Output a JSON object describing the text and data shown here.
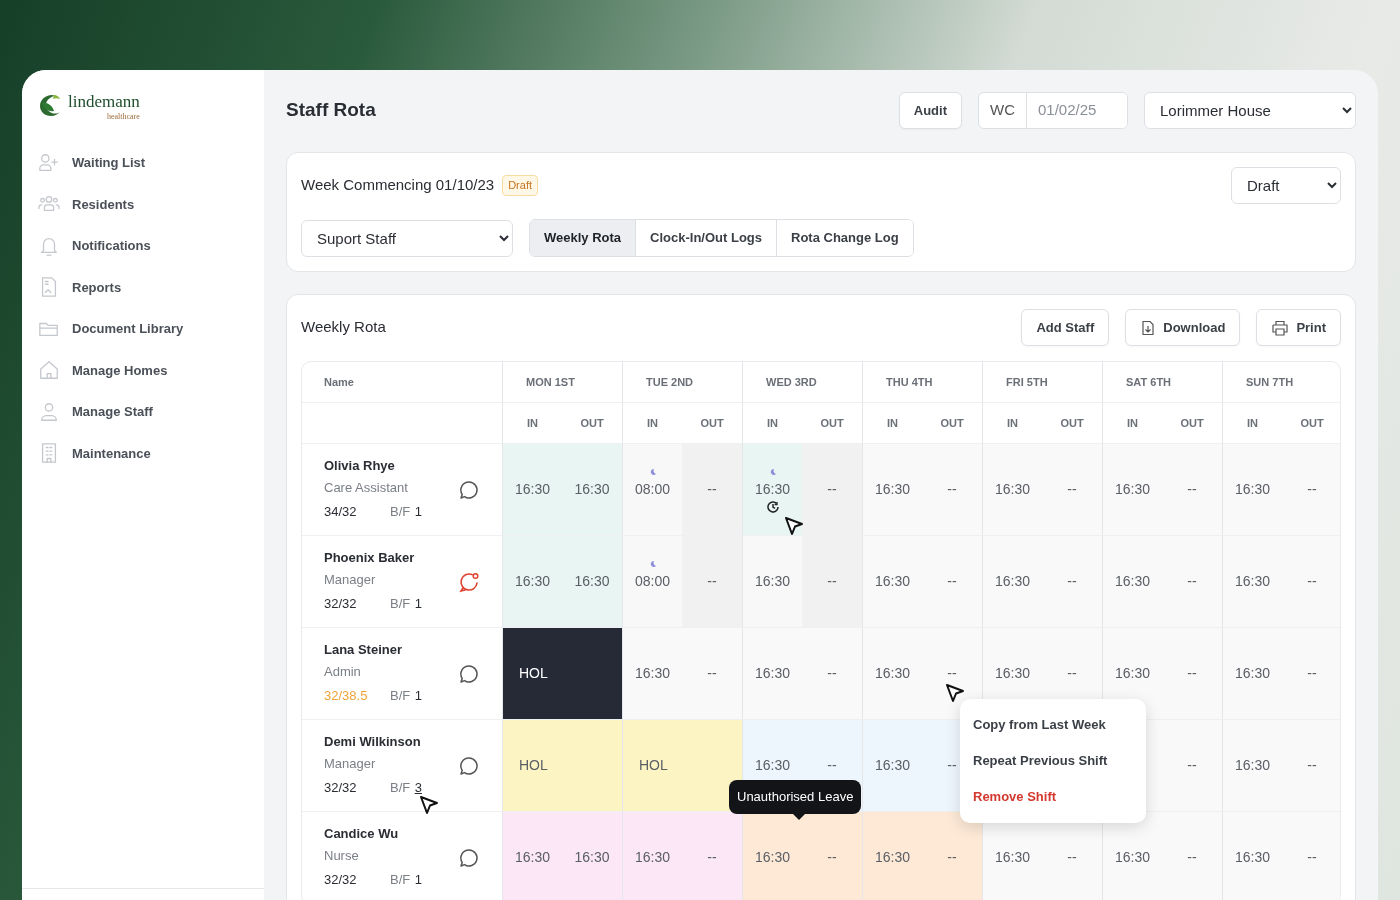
{
  "logo": {
    "name": "lindemann",
    "tagline": "healthcare"
  },
  "sidebar": {
    "items": [
      {
        "label": "Waiting List"
      },
      {
        "label": "Residents"
      },
      {
        "label": "Notifications"
      },
      {
        "label": "Reports"
      },
      {
        "label": "Document Library"
      },
      {
        "label": "Manage Homes"
      },
      {
        "label": "Manage Staff"
      },
      {
        "label": "Maintenance"
      }
    ]
  },
  "header": {
    "title": "Staff Rota",
    "audit_button": "Audit",
    "date_field": {
      "label": "WC",
      "placeholder": "01/02/25"
    },
    "home_select": "Lorimmer House"
  },
  "week_card": {
    "title": "Week Commencing 01/10/23",
    "badge": "Draft",
    "status_select": "Draft",
    "staff_select": "Suport Staff",
    "tabs": [
      {
        "label": "Weekly Rota",
        "selected": true
      },
      {
        "label": "Clock-In/Out Logs",
        "selected": false
      },
      {
        "label": "Rota Change Log",
        "selected": false
      }
    ]
  },
  "rota": {
    "title": "Weekly Rota",
    "buttons": [
      {
        "label": "Add Staff"
      },
      {
        "label": "Download"
      },
      {
        "label": "Print"
      }
    ],
    "name_column": "Name",
    "days": [
      {
        "label": "MON 1ST",
        "in": "IN",
        "out": "OUT"
      },
      {
        "label": "TUE 2ND",
        "in": "IN",
        "out": "OUT"
      },
      {
        "label": "WED 3RD",
        "in": "IN",
        "out": "OUT"
      },
      {
        "label": "THU 4TH",
        "in": "IN",
        "out": "OUT"
      },
      {
        "label": "FRI 5TH",
        "in": "IN",
        "out": "OUT"
      },
      {
        "label": "SAT 6TH",
        "in": "IN",
        "out": "OUT"
      },
      {
        "label": "SUN 7TH",
        "in": "IN",
        "out": "OUT"
      }
    ],
    "rows": [
      {
        "name": "Olivia Rhye",
        "role": "Care Assistant",
        "hours": "34/32",
        "over_hours": false,
        "bf_label": "B/F",
        "bf": "1",
        "bf_hover": false,
        "comment_alert": false,
        "cells": [
          {
            "kind": "shift",
            "night": false,
            "clock": false,
            "in": {
              "time": "16:30",
              "color": "#e9f5f3"
            },
            "out": {
              "time": "16:30",
              "color": "#e9f5f3"
            }
          },
          {
            "kind": "shift",
            "night": true,
            "clock": false,
            "in": {
              "time": "08:00",
              "color": "#f8f8f8"
            },
            "out": {
              "time": "--",
              "color": "#f1f1f1"
            }
          },
          {
            "kind": "shift",
            "night": true,
            "clock": true,
            "in": {
              "time": "16:30",
              "color": "#e9f5f3"
            },
            "out": {
              "time": "--",
              "color": "#f1f1f1"
            }
          },
          {
            "kind": "shift",
            "night": false,
            "clock": false,
            "in": {
              "time": "16:30",
              "color": "#f9f9f9"
            },
            "out": {
              "time": "--",
              "color": "#f9f9f9"
            }
          },
          {
            "kind": "shift",
            "night": false,
            "clock": false,
            "in": {
              "time": "16:30",
              "color": "#f9f9f9"
            },
            "out": {
              "time": "--",
              "color": "#f9f9f9"
            }
          },
          {
            "kind": "shift",
            "night": false,
            "clock": false,
            "in": {
              "time": "16:30",
              "color": "#f9f9f9"
            },
            "out": {
              "time": "--",
              "color": "#f9f9f9"
            }
          },
          {
            "kind": "shift",
            "night": false,
            "clock": false,
            "in": {
              "time": "16:30",
              "color": "#f9f9f9"
            },
            "out": {
              "time": "--",
              "color": "#f9f9f9"
            }
          }
        ]
      },
      {
        "name": "Phoenix Baker",
        "role": "Manager",
        "hours": "32/32",
        "over_hours": false,
        "bf_label": "B/F",
        "bf": "1",
        "bf_hover": false,
        "comment_alert": true,
        "cells": [
          {
            "kind": "shift",
            "night": false,
            "clock": false,
            "in": {
              "time": "16:30",
              "color": "#e9f5f3"
            },
            "out": {
              "time": "16:30",
              "color": "#e9f5f3"
            }
          },
          {
            "kind": "shift",
            "night": true,
            "clock": false,
            "in": {
              "time": "08:00",
              "color": "#f8f8f8"
            },
            "out": {
              "time": "--",
              "color": "#f1f1f1"
            }
          },
          {
            "kind": "shift",
            "night": false,
            "clock": false,
            "in": {
              "time": "16:30",
              "color": "#f8f8f8"
            },
            "out": {
              "time": "--",
              "color": "#f1f1f1"
            }
          },
          {
            "kind": "shift",
            "night": false,
            "clock": false,
            "in": {
              "time": "16:30",
              "color": "#f9f9f9"
            },
            "out": {
              "time": "--",
              "color": "#f9f9f9"
            }
          },
          {
            "kind": "shift",
            "night": false,
            "clock": false,
            "in": {
              "time": "16:30",
              "color": "#f9f9f9"
            },
            "out": {
              "time": "--",
              "color": "#f9f9f9"
            }
          },
          {
            "kind": "shift",
            "night": false,
            "clock": false,
            "in": {
              "time": "16:30",
              "color": "#f9f9f9"
            },
            "out": {
              "time": "--",
              "color": "#f9f9f9"
            }
          },
          {
            "kind": "shift",
            "night": false,
            "clock": false,
            "in": {
              "time": "16:30",
              "color": "#f9f9f9"
            },
            "out": {
              "time": "--",
              "color": "#f9f9f9"
            }
          }
        ]
      },
      {
        "name": "Lana Steiner",
        "role": "Admin",
        "hours": "32/38.5",
        "over_hours": true,
        "bf_label": "B/F",
        "bf": "1",
        "bf_hover": false,
        "comment_alert": false,
        "cells": [
          {
            "kind": "holiday",
            "color": "#252a36",
            "label": "HOL"
          },
          {
            "kind": "shift",
            "night": false,
            "clock": false,
            "in": {
              "time": "16:30",
              "color": "#f9f9f9"
            },
            "out": {
              "time": "--",
              "color": "#f9f9f9"
            }
          },
          {
            "kind": "shift",
            "night": false,
            "clock": false,
            "in": {
              "time": "16:30",
              "color": "#f9f9f9"
            },
            "out": {
              "time": "--",
              "color": "#f9f9f9"
            }
          },
          {
            "kind": "shift",
            "night": false,
            "clock": false,
            "in": {
              "time": "16:30",
              "color": "#f9f9f9"
            },
            "out": {
              "time": "--",
              "color": "#f9f9f9"
            }
          },
          {
            "kind": "shift",
            "night": false,
            "clock": false,
            "in": {
              "time": "16:30",
              "color": "#f9f9f9"
            },
            "out": {
              "time": "--",
              "color": "#f9f9f9"
            }
          },
          {
            "kind": "shift",
            "night": false,
            "clock": false,
            "in": {
              "time": "16:30",
              "color": "#f9f9f9"
            },
            "out": {
              "time": "--",
              "color": "#f9f9f9"
            }
          },
          {
            "kind": "shift",
            "night": false,
            "clock": false,
            "in": {
              "time": "16:30",
              "color": "#f9f9f9"
            },
            "out": {
              "time": "--",
              "color": "#f9f9f9"
            }
          }
        ]
      },
      {
        "name": "Demi Wilkinson",
        "role": "Manager",
        "hours": "32/32",
        "over_hours": false,
        "bf_label": "B/F",
        "bf": "3",
        "bf_hover": true,
        "comment_alert": false,
        "cells": [
          {
            "kind": "holiday",
            "color": "#fdf4c4",
            "label": "HOL"
          },
          {
            "kind": "holiday",
            "color": "#fdf4c4",
            "label": "HOL"
          },
          {
            "kind": "shift",
            "night": false,
            "clock": false,
            "in": {
              "time": "16:30",
              "color": "#eef6fd"
            },
            "out": {
              "time": "--",
              "color": "#eef6fd"
            }
          },
          {
            "kind": "shift",
            "night": false,
            "clock": false,
            "in": {
              "time": "16:30",
              "color": "#eef6fd"
            },
            "out": {
              "time": "--",
              "color": "#eef6fd"
            }
          },
          {
            "kind": "hidden"
          },
          {
            "kind": "shift",
            "out": {
              "time": "--",
              "color": "#f9f9f9"
            }
          },
          {
            "kind": "shift",
            "night": false,
            "clock": false,
            "in": {
              "time": "16:30",
              "color": "#f9f9f9"
            },
            "out": {
              "time": "--",
              "color": "#f9f9f9"
            }
          }
        ]
      },
      {
        "name": "Candice Wu",
        "role": "Nurse",
        "hours": "32/32",
        "over_hours": false,
        "bf_label": "B/F",
        "bf": "1",
        "bf_hover": false,
        "comment_alert": false,
        "cells": [
          {
            "kind": "shift",
            "night": false,
            "clock": false,
            "in": {
              "time": "16:30",
              "color": "#fbe7f5"
            },
            "out": {
              "time": "16:30",
              "color": "#fbe7f5"
            }
          },
          {
            "kind": "shift",
            "night": false,
            "clock": false,
            "in": {
              "time": "16:30",
              "color": "#fbe7f5"
            },
            "out": {
              "time": "--",
              "color": "#fbe7f5"
            }
          },
          {
            "kind": "shift",
            "night": false,
            "clock": false,
            "in": {
              "time": "16:30",
              "color": "#fde9d6"
            },
            "out": {
              "time": "--",
              "color": "#fde9d6"
            }
          },
          {
            "kind": "shift",
            "night": false,
            "clock": false,
            "in": {
              "time": "16:30",
              "color": "#fde9d6"
            },
            "out": {
              "time": "--",
              "color": "#fde9d6"
            }
          },
          {
            "kind": "shift",
            "night": false,
            "clock": false,
            "in": {
              "time": "16:30",
              "color": "#f9f9f9"
            },
            "out": {
              "time": "--",
              "color": "#f9f9f9"
            }
          },
          {
            "kind": "shift",
            "night": false,
            "clock": false,
            "in": {
              "time": "16:30",
              "color": "#f9f9f9"
            },
            "out": {
              "time": "--",
              "color": "#f9f9f9"
            }
          },
          {
            "kind": "shift",
            "night": false,
            "clock": false,
            "in": {
              "time": "16:30",
              "color": "#f9f9f9"
            },
            "out": {
              "time": "--",
              "color": "#f9f9f9"
            }
          }
        ]
      }
    ],
    "tooltip": {
      "text": "Unauthorised Leave"
    },
    "context_menu": [
      {
        "label": "Copy from Last Week",
        "kind": "normal"
      },
      {
        "label": "Repeat Previous Shift",
        "kind": "normal"
      },
      {
        "label": "Remove Shift",
        "kind": "danger"
      }
    ]
  }
}
